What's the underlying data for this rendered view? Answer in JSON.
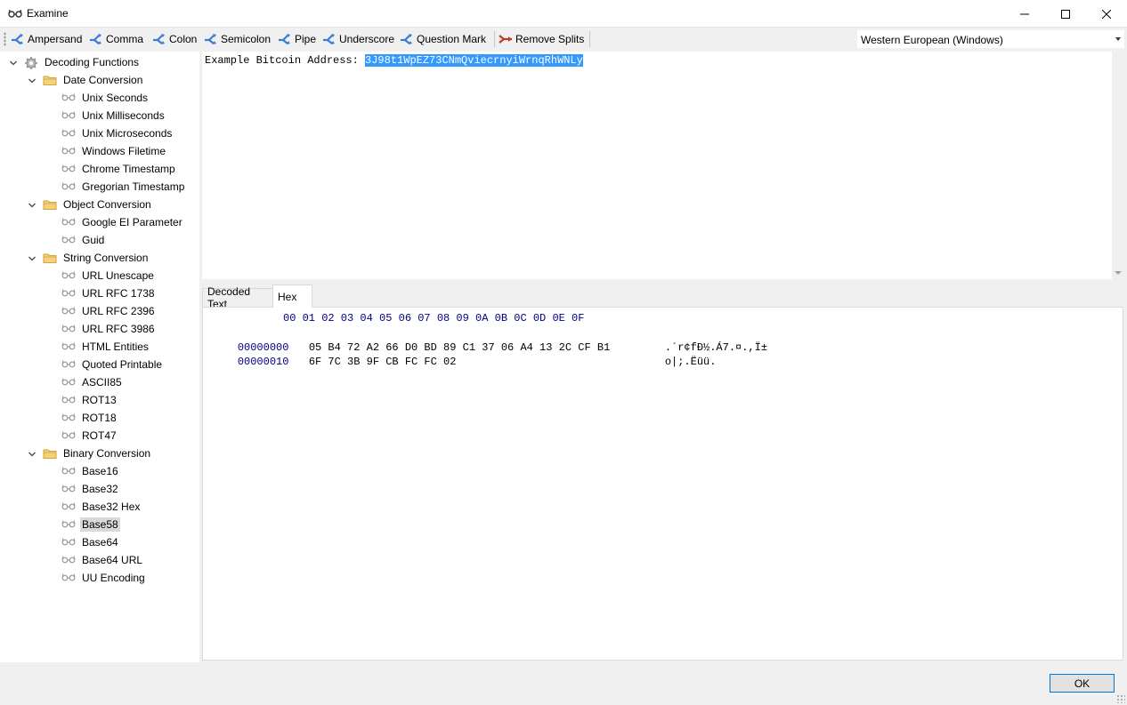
{
  "window": {
    "title": "Examine"
  },
  "toolbar": {
    "buttons": [
      {
        "label": "Ampersand"
      },
      {
        "label": "Comma"
      },
      {
        "label": "Colon"
      },
      {
        "label": "Semicolon"
      },
      {
        "label": "Pipe"
      },
      {
        "label": "Underscore"
      },
      {
        "label": "Question Mark"
      },
      {
        "label": "Remove Splits"
      }
    ],
    "encoding": "Western European (Windows)"
  },
  "tree": {
    "root": "Decoding Functions",
    "groups": [
      {
        "label": "Date Conversion",
        "items": [
          "Unix Seconds",
          "Unix Milliseconds",
          "Unix Microseconds",
          "Windows Filetime",
          "Chrome Timestamp",
          "Gregorian Timestamp"
        ]
      },
      {
        "label": "Object Conversion",
        "items": [
          "Google EI Parameter",
          "Guid"
        ]
      },
      {
        "label": "String Conversion",
        "items": [
          "URL Unescape",
          "URL RFC 1738",
          "URL RFC 2396",
          "URL RFC 3986",
          "HTML Entities",
          "Quoted Printable",
          "ASCII85",
          "ROT13",
          "ROT18",
          "ROT47"
        ]
      },
      {
        "label": "Binary Conversion",
        "items": [
          "Base16",
          "Base32",
          "Base32 Hex",
          "Base58",
          "Base64",
          "Base64 URL",
          "UU Encoding"
        ]
      }
    ],
    "selected": "Base58"
  },
  "editor": {
    "prefix": "Example Bitcoin Address: ",
    "selected_text": "3J98t1WpEZ73CNmQviecrnyiWrnqRhWNLy"
  },
  "tabs": [
    {
      "label": "Decoded Text"
    },
    {
      "label": "Hex"
    }
  ],
  "hex": {
    "header": "00 01 02 03 04 05 06 07 08 09 0A 0B 0C 0D 0E 0F",
    "rows": [
      {
        "offset": "00000000",
        "bytes": "05 B4 72 A2 66 D0 BD 89 C1 37 06 A4 13 2C CF B1",
        "ascii": ".´r¢fÐ½.Á7.¤.,Ï±"
      },
      {
        "offset": "00000010",
        "bytes": "6F 7C 3B 9F CB FC FC 02",
        "ascii": "o|;.Ëüü."
      }
    ]
  },
  "footer": {
    "ok_label": "OK"
  },
  "colors": {
    "accent": "#0078d7",
    "selection": "#3399ff",
    "hex_offset": "#000080",
    "split_icon": "#3a7bd5",
    "remove_icon": "#c0392b",
    "folder": "#e8b84a"
  }
}
